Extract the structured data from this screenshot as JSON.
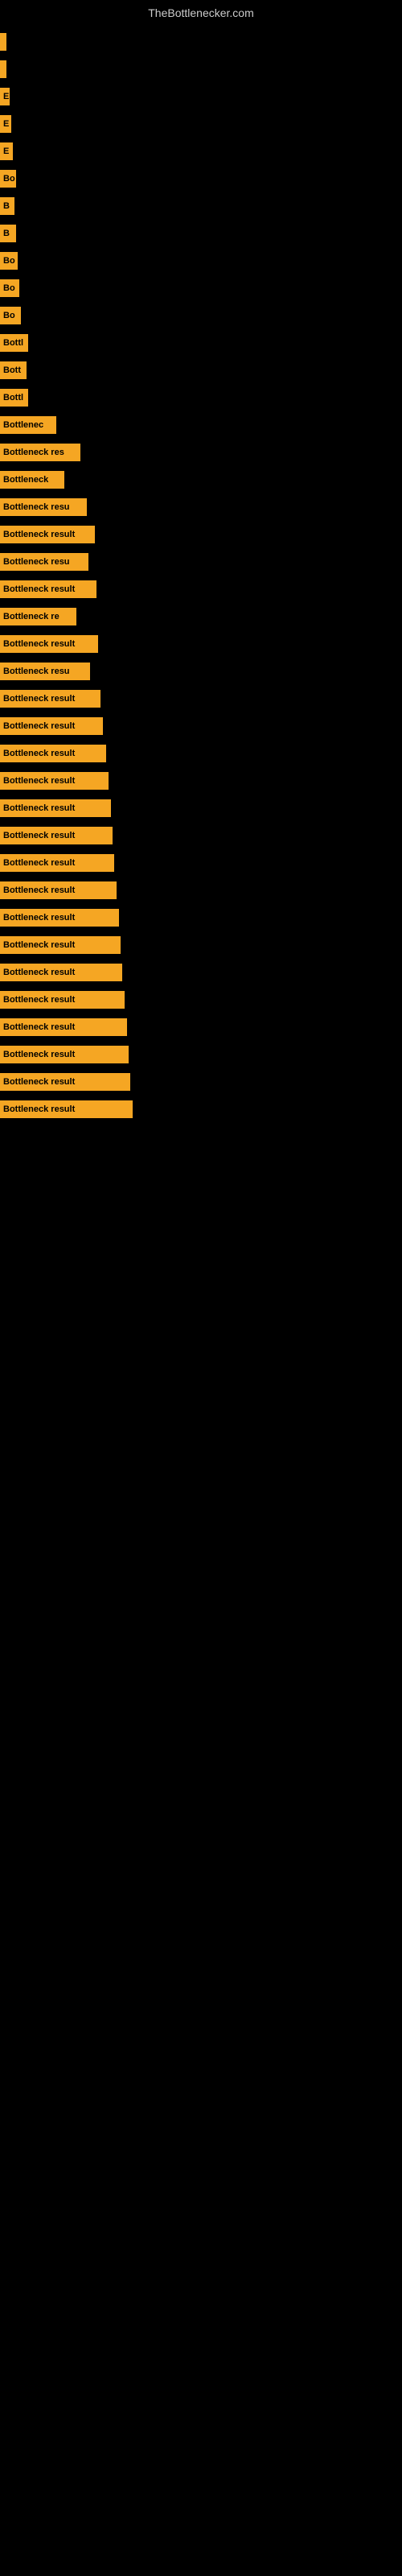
{
  "site": {
    "title": "TheBottlenecker.com"
  },
  "bars": [
    {
      "label": "",
      "width": 8
    },
    {
      "label": "",
      "width": 8
    },
    {
      "label": "E",
      "width": 12
    },
    {
      "label": "E",
      "width": 14
    },
    {
      "label": "E",
      "width": 16
    },
    {
      "label": "Bo",
      "width": 20
    },
    {
      "label": "B",
      "width": 18
    },
    {
      "label": "B",
      "width": 20
    },
    {
      "label": "Bo",
      "width": 22
    },
    {
      "label": "Bo",
      "width": 24
    },
    {
      "label": "Bo",
      "width": 26
    },
    {
      "label": "Bottl",
      "width": 35
    },
    {
      "label": "Bott",
      "width": 33
    },
    {
      "label": "Bottl",
      "width": 35
    },
    {
      "label": "Bottlenec",
      "width": 70
    },
    {
      "label": "Bottleneck res",
      "width": 100
    },
    {
      "label": "Bottleneck",
      "width": 80
    },
    {
      "label": "Bottleneck resu",
      "width": 108
    },
    {
      "label": "Bottleneck result",
      "width": 118
    },
    {
      "label": "Bottleneck resu",
      "width": 110
    },
    {
      "label": "Bottleneck result",
      "width": 120
    },
    {
      "label": "Bottleneck re",
      "width": 95
    },
    {
      "label": "Bottleneck result",
      "width": 122
    },
    {
      "label": "Bottleneck resu",
      "width": 112
    },
    {
      "label": "Bottleneck result",
      "width": 125
    },
    {
      "label": "Bottleneck result",
      "width": 128
    },
    {
      "label": "Bottleneck result",
      "width": 132
    },
    {
      "label": "Bottleneck result",
      "width": 135
    },
    {
      "label": "Bottleneck result",
      "width": 138
    },
    {
      "label": "Bottleneck result",
      "width": 140
    },
    {
      "label": "Bottleneck result",
      "width": 142
    },
    {
      "label": "Bottleneck result",
      "width": 145
    },
    {
      "label": "Bottleneck result",
      "width": 148
    },
    {
      "label": "Bottleneck result",
      "width": 150
    },
    {
      "label": "Bottleneck result",
      "width": 152
    },
    {
      "label": "Bottleneck result",
      "width": 155
    },
    {
      "label": "Bottleneck result",
      "width": 158
    },
    {
      "label": "Bottleneck result",
      "width": 160
    },
    {
      "label": "Bottleneck result",
      "width": 162
    },
    {
      "label": "Bottleneck result",
      "width": 165
    }
  ]
}
